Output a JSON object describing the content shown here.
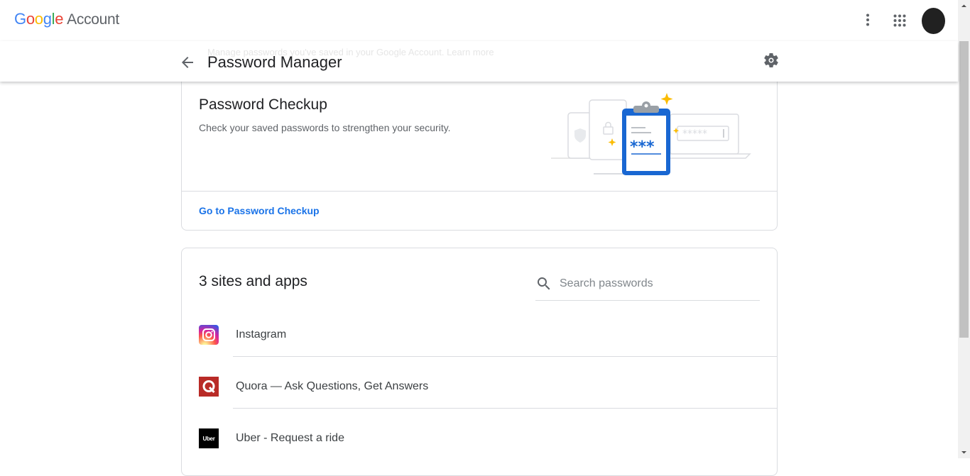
{
  "header": {
    "logo_google": [
      "G",
      "o",
      "o",
      "g",
      "l",
      "e"
    ],
    "logo_google_colors": [
      "#4285F4",
      "#EA4335",
      "#FBBC05",
      "#4285F4",
      "#34A853",
      "#EA4335"
    ],
    "logo_account": "Account",
    "more_icon": "more-vert-icon",
    "apps_icon": "apps-grid-icon"
  },
  "subheader": {
    "title": "Password Manager",
    "faded_text": "Manage passwords you've saved in your Google Account. Learn more",
    "back_icon": "arrow-back-icon",
    "settings_icon": "gear-icon"
  },
  "checkup": {
    "title": "Password Checkup",
    "description": "Check your saved passwords to strengthen your security.",
    "link": "Go to Password Checkup",
    "illustration_text": "***"
  },
  "sites": {
    "title": "3 sites and apps",
    "search_placeholder": "Search passwords",
    "search_value": "",
    "items": [
      {
        "name": "Instagram",
        "icon": "instagram-icon"
      },
      {
        "name": "Quora — Ask Questions, Get Answers",
        "icon": "quora-icon"
      },
      {
        "name": "Uber - Request a ride",
        "icon": "uber-icon",
        "icon_text": "Uber"
      }
    ]
  },
  "colors": {
    "link": "#1a73e8",
    "clipboard": "#1967d2",
    "sparkle": "#fbbc04"
  }
}
